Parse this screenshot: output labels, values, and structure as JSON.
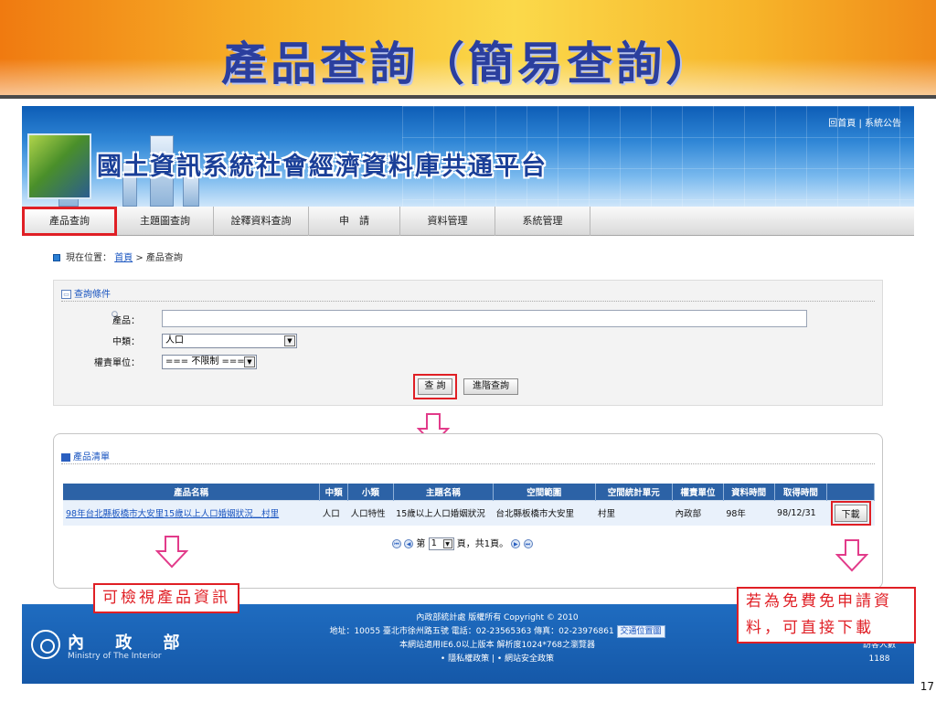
{
  "slide": {
    "title": "產品查詢（簡易查詢）",
    "page_number": "17"
  },
  "banner": {
    "title": "國土資訊系統社會經濟資料庫共通平台",
    "links": "回首頁 | 系統公告"
  },
  "nav": {
    "items": [
      "產品查詢",
      "主題圖查詢",
      "詮釋資料查詢",
      "申　請",
      "資料管理",
      "系統管理"
    ]
  },
  "breadcrumb": {
    "prefix": "現在位置：",
    "home": "首頁",
    "current": "> 產品查詢"
  },
  "query": {
    "header": "查詢條件",
    "product_label": "產品：",
    "product_value": "",
    "category_label": "中類：",
    "category_value": "人口",
    "authority_label": "權責單位：",
    "authority_value": "=== 不限制 ===",
    "search_button": "查 詢",
    "advanced_button": "進階查詢"
  },
  "product_list": {
    "header": "產品清單",
    "columns": [
      "產品名稱",
      "中類",
      "小類",
      "主題名稱",
      "空間範圍",
      "空間統計單元",
      "權責單位",
      "資料時間",
      "取得時間",
      ""
    ],
    "rows": [
      [
        "98年台北縣板橋市大安里15歲以上人口婚姻狀況＿村里",
        "人口",
        "人口特性",
        "15歲以上人口婚姻狀況",
        "台北縣板橋市大安里",
        "村里",
        "內政部",
        "98年",
        "98/12/31",
        "下載"
      ]
    ],
    "pager": {
      "before": "第",
      "page": "1",
      "after": "頁，共1頁。"
    }
  },
  "callouts": {
    "view_info": "可檢視產品資訊",
    "download": "若為免費免申請資料，可直接下載"
  },
  "footer": {
    "org_name": "內 政 部",
    "org_en": "Ministry of The Interior",
    "copyright": "內政部統計處 版權所有 Copyright © 2010",
    "address": "地址：10055 臺北市徐州路五號 電話：02-23565363 傳真：02-23976861",
    "map_link": "交通位置圖",
    "browser_note": "本網站適用IE6.0以上版本 解析度1024*768之瀏覽器",
    "privacy": "隱私權政策",
    "security": "網站安全政策",
    "visitors_label": "訪客人數",
    "visitors_count": "1188"
  },
  "colors": {
    "accent_red": "#e01f25",
    "title_blue": "#2b3f9e",
    "table_header": "#2c62a6",
    "footer_blue": "#1558a8"
  }
}
